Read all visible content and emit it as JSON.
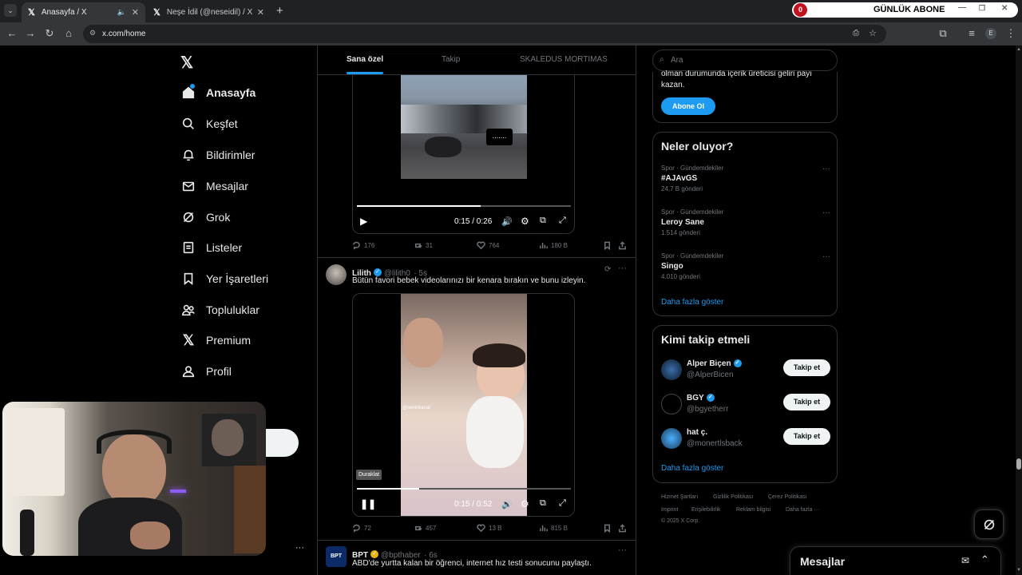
{
  "browser": {
    "tabs": [
      {
        "title": "Anasayfa / X",
        "icon": "x-logo-icon",
        "active": true
      },
      {
        "title": "Neşe İdil (@neseidil) / X",
        "icon": "x-logo-icon",
        "active": false
      }
    ],
    "url": "x.com/home"
  },
  "subscriber_widget": {
    "count": "0",
    "label": "GÜNLÜK ABONE"
  },
  "nav": {
    "items": [
      {
        "label": "Anasayfa",
        "icon": "home-icon"
      },
      {
        "label": "Keşfet",
        "icon": "search-icon"
      },
      {
        "label": "Bildirimler",
        "icon": "bell-icon"
      },
      {
        "label": "Mesajlar",
        "icon": "mail-icon"
      },
      {
        "label": "Grok",
        "icon": "grok-icon"
      },
      {
        "label": "Listeler",
        "icon": "list-icon"
      },
      {
        "label": "Yer İşaretleri",
        "icon": "bookmark-icon"
      },
      {
        "label": "Topluluklar",
        "icon": "community-icon"
      },
      {
        "label": "Premium",
        "icon": "x-logo-icon"
      },
      {
        "label": "Profil",
        "icon": "person-icon"
      }
    ],
    "more": "···"
  },
  "feed": {
    "tabs": [
      "Sana özel",
      "Takip",
      "SKALEDUS MORTIMAS"
    ],
    "post1": {
      "video_overlay": ".......",
      "video_time": "0:15 / 0:26",
      "progress": 0.58,
      "replies": "176",
      "reposts": "31",
      "likes": "764",
      "views": "180 B"
    },
    "post2": {
      "name": "Lilith",
      "handle": "@lilith0",
      "time": "· 5s",
      "text": "Bütün favori bebek videolarınızı bir kenara bırakın ve bunu izleyin.",
      "watermark": "@seninkanal",
      "tooltip": "Duraklat",
      "video_time": "0:15 / 0:52",
      "progress": 0.29,
      "replies": "72",
      "reposts": "457",
      "likes": "13 B",
      "views": "815 B"
    },
    "post3": {
      "name": "BPT",
      "handle": "@bpthaber",
      "time": "· 6s",
      "avatar_text": "BPT",
      "text": "ABD'de yurtta kalan bir öğrenci, internet hız testi sonucunu paylaştı."
    }
  },
  "right": {
    "search_placeholder": "Ara",
    "premium": {
      "text_line1": "olman durumunda içerik üreticisi geliri payı",
      "text_line2": "kazan.",
      "button": "Abone Ol"
    },
    "trends": {
      "title": "Neler oluyor?",
      "items": [
        {
          "category": "Spor · Gündemdekiler",
          "title": "#AJAvGS",
          "count": "24,7 B gönderi"
        },
        {
          "category": "Spor · Gündemdekiler",
          "title": "Leroy Sane",
          "count": "1.514 gönderi"
        },
        {
          "category": "Spor · Gündemdekiler",
          "title": "Singo",
          "count": "4.010 gönderi"
        }
      ],
      "show_more": "Daha fazla göster"
    },
    "who_to_follow": {
      "title": "Kimi takip etmeli",
      "items": [
        {
          "name": "Alper Biçen",
          "handle": "@AlperBicen",
          "button": "Takip et"
        },
        {
          "name": "BGY",
          "handle": "@bgyetherr",
          "button": "Takip et"
        },
        {
          "name": "hat ç.",
          "handle": "@monertlsback",
          "button": "Takip et"
        }
      ],
      "show_more": "Daha fazla göster"
    },
    "footer": {
      "links_row1": [
        "Hizmet Şartları",
        "Gizlilik Politikası",
        "Çerez Politikası"
      ],
      "links_row2": [
        "Imprint",
        "Erişilebilirlik",
        "Reklam bilgisi",
        "Daha fazla ···"
      ],
      "copyright": "© 2025 X Corp."
    },
    "messages_title": "Mesajlar"
  },
  "colors": {
    "accent": "#1d9bf0",
    "bg": "#000000",
    "border": "#2f3336",
    "muted": "#71767b"
  }
}
